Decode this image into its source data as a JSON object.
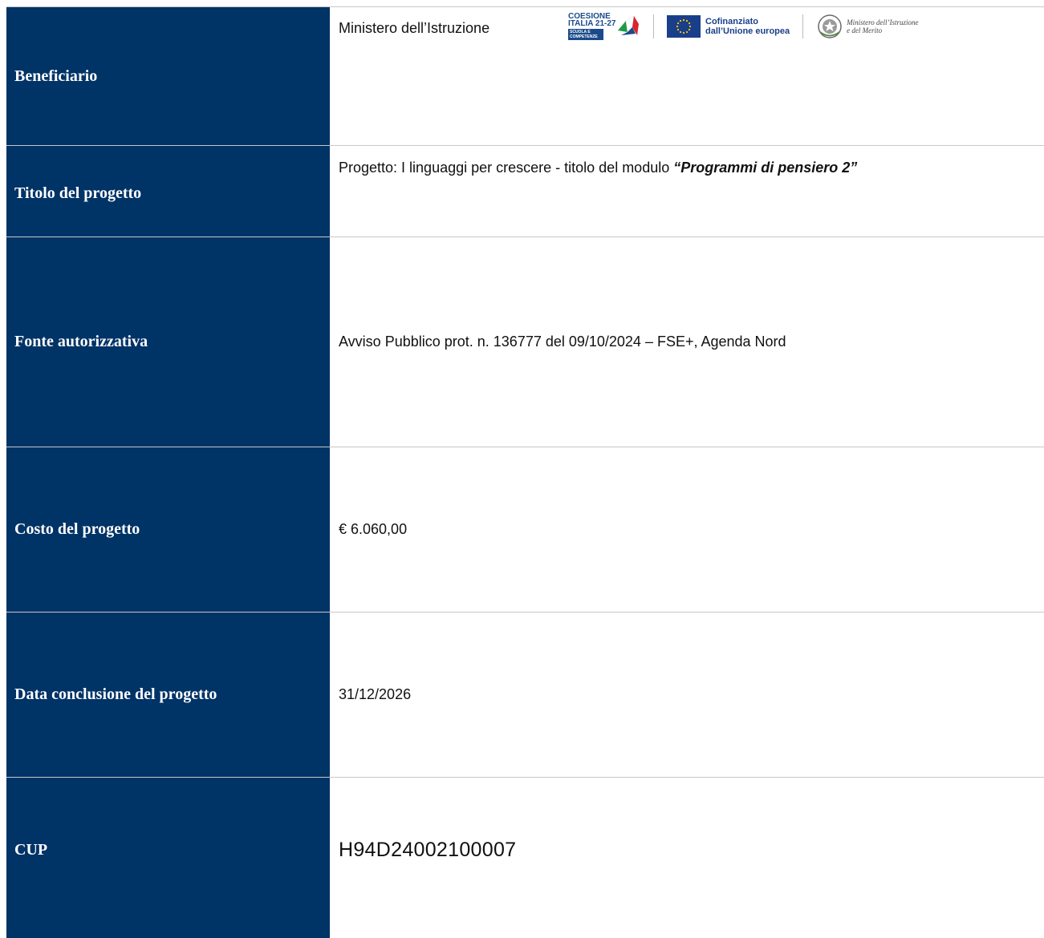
{
  "rows": [
    {
      "label": "Beneficiario",
      "value": "Ministero dell’Istruzione"
    },
    {
      "label": "Titolo del progetto",
      "value_prefix": "Progetto: I linguaggi per crescere  - titolo del modulo ",
      "value_emph": "“Programmi di pensiero 2”"
    },
    {
      "label": "Fonte autorizzativa",
      "value": "Avviso Pubblico prot. n. 136777 del 09/10/2024 – FSE+, Agenda Nord"
    },
    {
      "label": "Costo del progetto",
      "value": "€ 6.060,00"
    },
    {
      "label": "Data conclusione del progetto",
      "value": "31/12/2026"
    },
    {
      "label": "CUP",
      "value": "H94D24002100007"
    }
  ],
  "logos": {
    "coesione_line1": "COESIONE",
    "coesione_line2": "ITALIA 21-27",
    "coesione_band": "SCUOLA E COMPETENZE",
    "eu_line1": "Cofinanziato",
    "eu_line2": "dall’Unione europea",
    "ministry_line1": "Ministero dell’Istruzione",
    "ministry_line2": "e del Merito",
    "colors": {
      "navy": "#003366",
      "eu_blue": "#1a3f8a",
      "eu_star": "#ffcc00",
      "italy_green": "#1e9b45",
      "italy_red": "#d7262e"
    }
  }
}
